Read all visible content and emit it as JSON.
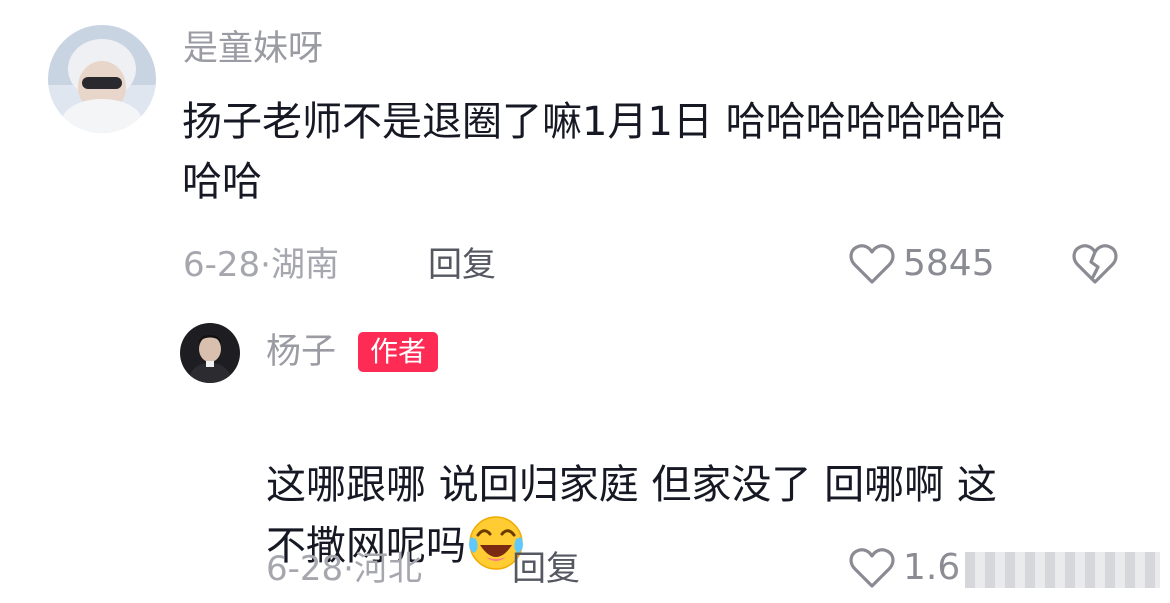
{
  "comments": [
    {
      "username": "是童妹呀",
      "text": "扬子老师不是退圈了嘛1月1日 哈哈哈哈哈哈哈\n哈哈",
      "date": "6-28",
      "separator": "·",
      "location": "湖南",
      "reply_label": "回复",
      "likes": "5845"
    },
    {
      "username": "杨子",
      "badge": "作者",
      "text": "这哪跟哪 说回归家庭 但家没了 回哪啊 这\n不撒网呢吗",
      "emoji": "face-with-tears-of-joy",
      "date": "6-28",
      "separator": "·",
      "location": "河北",
      "reply_label": "回复",
      "likes": "1.6"
    }
  ],
  "colors": {
    "text": "#161823",
    "username": "#9a9ba3",
    "meta": "#a6a7ae",
    "badge_bg": "#fe2c55",
    "badge_text": "#ffffff"
  }
}
